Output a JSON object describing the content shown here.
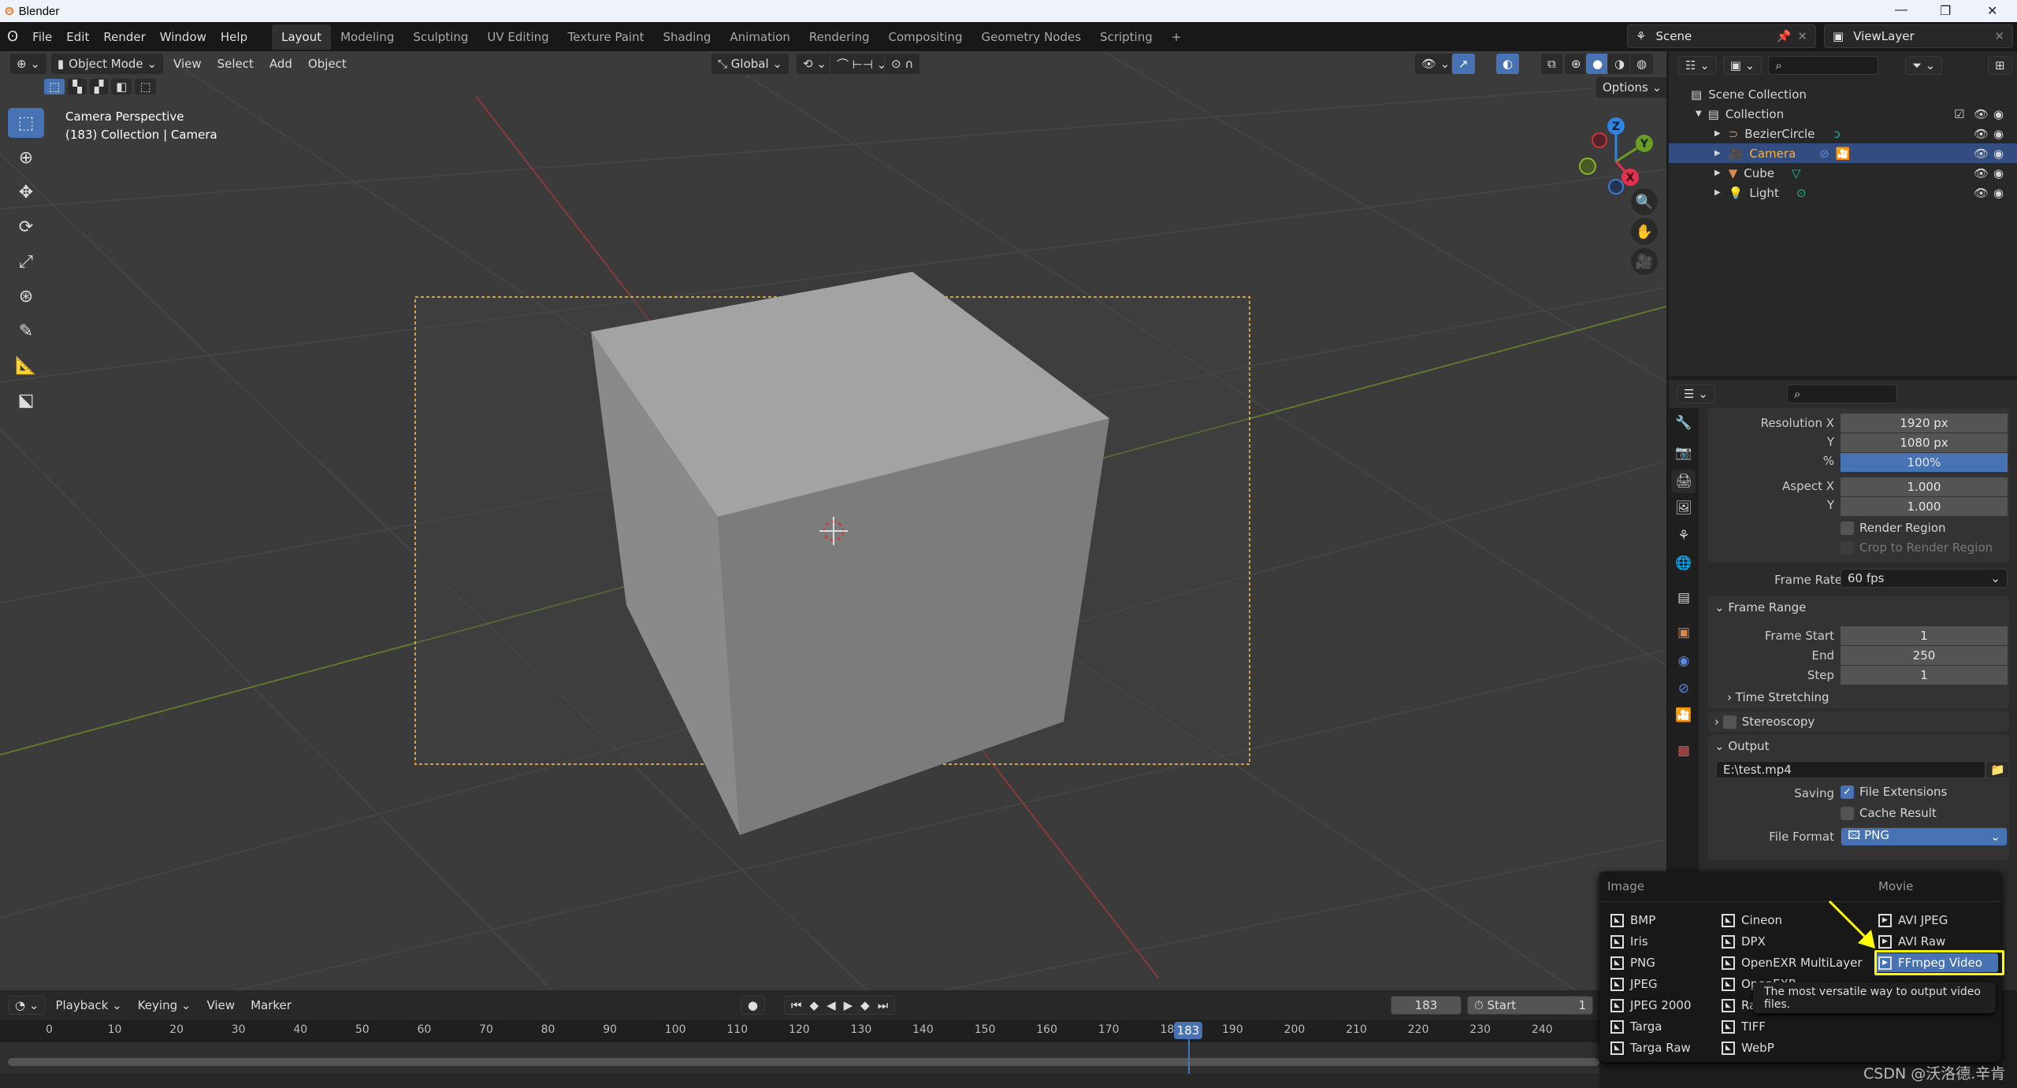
{
  "window": {
    "title": "Blender"
  },
  "menu": [
    "File",
    "Edit",
    "Render",
    "Window",
    "Help"
  ],
  "workspaces": [
    "Layout",
    "Modeling",
    "Sculpting",
    "UV Editing",
    "Texture Paint",
    "Shading",
    "Animation",
    "Rendering",
    "Compositing",
    "Geometry Nodes",
    "Scripting",
    "+"
  ],
  "scene": {
    "name": "Scene",
    "view_layer": "ViewLayer"
  },
  "viewport": {
    "mode": "Object Mode",
    "menus": [
      "View",
      "Select",
      "Add",
      "Object"
    ],
    "orientation": "Global",
    "options": "Options",
    "overlay_title": "Camera Perspective",
    "overlay_sub": "(183) Collection | Camera",
    "gizmo": {
      "x": "X",
      "y": "Y",
      "z": "Z"
    }
  },
  "outliner": {
    "scene_collection": "Scene Collection",
    "collection": "Collection",
    "items": [
      {
        "name": "BezierCircle",
        "icon": "curve-icon"
      },
      {
        "name": "Camera",
        "icon": "camera-icon",
        "selected": true
      },
      {
        "name": "Cube",
        "icon": "mesh-icon"
      },
      {
        "name": "Light",
        "icon": "light-icon"
      }
    ]
  },
  "properties": {
    "resolution_x_label": "Resolution X",
    "resolution_x": "1920 px",
    "y_label": "Y",
    "resolution_y": "1080 px",
    "pct_label": "%",
    "resolution_pct": "100%",
    "aspect_x_label": "Aspect X",
    "aspect_x": "1.000",
    "aspect_y": "1.000",
    "render_region": "Render Region",
    "crop_region": "Crop to Render Region",
    "frame_rate_label": "Frame Rate",
    "frame_rate": "60 fps",
    "frame_range": "Frame Range",
    "frame_start_label": "Frame Start",
    "frame_start": "1",
    "end_label": "End",
    "frame_end": "250",
    "step_label": "Step",
    "step": "1",
    "time_stretching": "Time Stretching",
    "stereoscopy": "Stereoscopy",
    "output": "Output",
    "output_path": "E:\\test.mp4",
    "saving_label": "Saving",
    "file_extensions": "File Extensions",
    "file_extensions_checked": true,
    "cache_result": "Cache Result",
    "file_format_label": "File Format",
    "file_format": "PNG"
  },
  "file_format_menu": {
    "image_header": "Image",
    "movie_header": "Movie",
    "image_col1": [
      "BMP",
      "Iris",
      "PNG",
      "JPEG",
      "JPEG 2000",
      "Targa",
      "Targa Raw"
    ],
    "image_col2": [
      "Cineon",
      "DPX",
      "OpenEXR MultiLayer",
      "OpenEXR",
      "Radiance HDR",
      "TIFF",
      "WebP"
    ],
    "movie": [
      "AVI JPEG",
      "AVI Raw",
      "FFmpeg Video"
    ],
    "highlighted": "FFmpeg Video",
    "tooltip": "The most versatile way to output video files."
  },
  "timeline": {
    "menus": [
      "Playback",
      "Keying",
      "View",
      "Marker"
    ],
    "current_frame": "183",
    "start_label": "Start",
    "start": "1",
    "ticks": [
      "0",
      "10",
      "20",
      "30",
      "40",
      "50",
      "60",
      "70",
      "80",
      "90",
      "100",
      "110",
      "120",
      "130",
      "140",
      "150",
      "160",
      "170",
      "180",
      "183",
      "190",
      "200",
      "210",
      "220",
      "230",
      "240"
    ]
  },
  "watermark": "CSDN @沃洛德.辛肯",
  "colors": {
    "accent": "#4772b3",
    "annotation": "#ffff00",
    "selected_text": "#ffaf29"
  }
}
